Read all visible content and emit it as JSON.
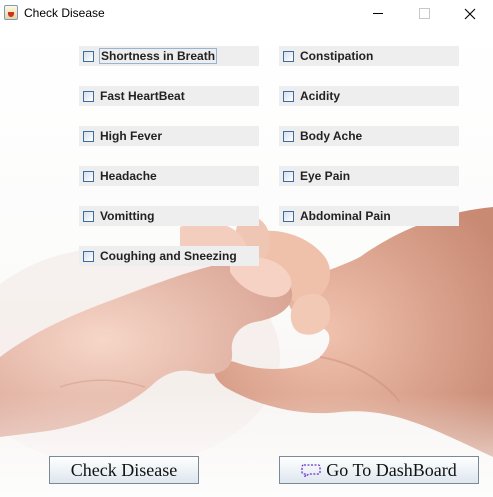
{
  "window": {
    "title": "Check Disease",
    "icon": "java-cup-icon"
  },
  "symptoms": {
    "left": [
      {
        "label": "Shortness in Breath",
        "checked": false,
        "focused": true
      },
      {
        "label": "Fast HeartBeat",
        "checked": false
      },
      {
        "label": "High Fever",
        "checked": false
      },
      {
        "label": "Headache",
        "checked": false
      },
      {
        "label": "Vomitting",
        "checked": false
      },
      {
        "label": "Coughing and Sneezing",
        "checked": false
      }
    ],
    "right": [
      {
        "label": "Constipation",
        "checked": false
      },
      {
        "label": "Acidity",
        "checked": false
      },
      {
        "label": "Body Ache",
        "checked": false
      },
      {
        "label": "Eye Pain",
        "checked": false
      },
      {
        "label": "Abdominal Pain",
        "checked": false
      }
    ]
  },
  "buttons": {
    "check_disease": "Check Disease",
    "dashboard": "Go To DashBoard",
    "dashboard_icon": "dashed-speech-bubble-icon"
  },
  "colors": {
    "checkbox_bg": "#eeeeee",
    "checkbox_border": "#3c6ea2",
    "button_border": "#7a8a99",
    "dashboard_icon": "#6b2fd0"
  }
}
